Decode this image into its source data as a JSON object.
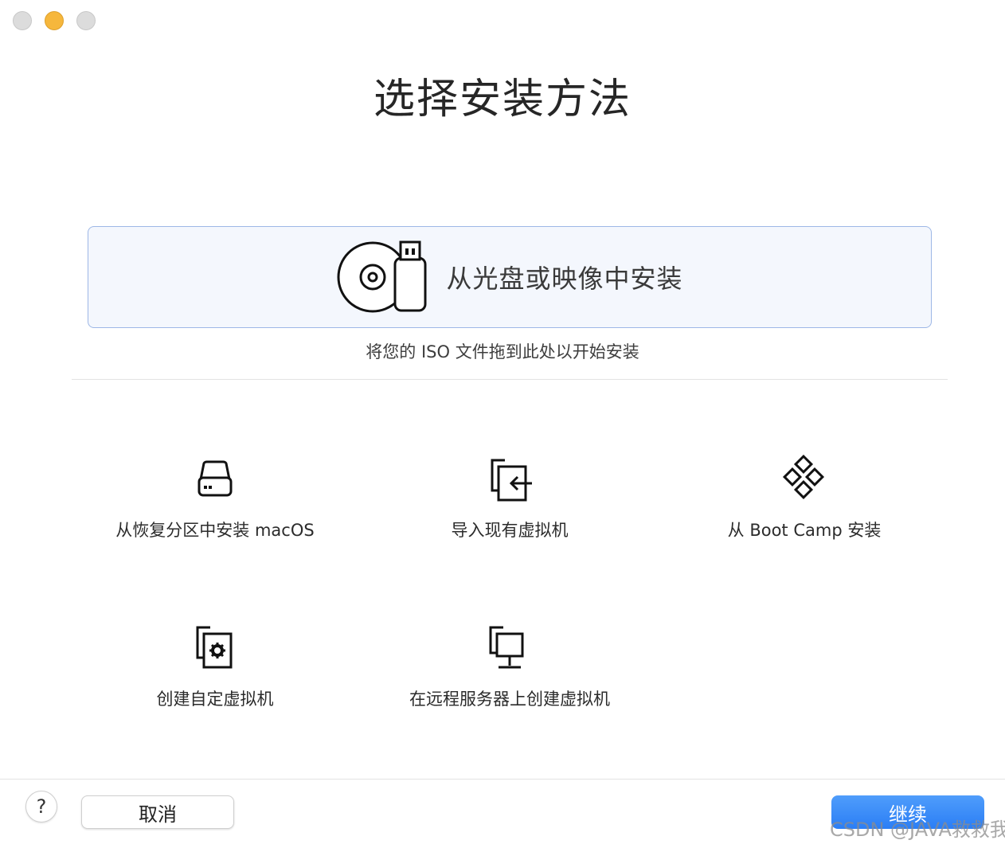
{
  "window": {
    "title": "选择安装方法"
  },
  "drop_zone": {
    "label": "从光盘或映像中安装",
    "icon": "disc-usb-icon",
    "hint": "将您的 ISO 文件拖到此处以开始安装"
  },
  "options": [
    {
      "label": "从恢复分区中安装 macOS",
      "icon": "hard-drive-icon"
    },
    {
      "label": "导入现有虚拟机",
      "icon": "import-vm-icon"
    },
    {
      "label": "从 Boot Camp 安装",
      "icon": "bootcamp-diamond-icon"
    },
    {
      "label": "创建自定虚拟机",
      "icon": "custom-vm-gear-icon"
    },
    {
      "label": "在远程服务器上创建虚拟机",
      "icon": "remote-server-icon"
    }
  ],
  "footer": {
    "help_label": "?",
    "cancel_label": "取消",
    "continue_label": "继续"
  },
  "watermark": "CSDN @JAVA救救我",
  "colors": {
    "accent": "#2b7ef5",
    "drop_zone_bg": "#f4f7fd",
    "drop_zone_border": "#9db7e6",
    "minimize": "#f6b73c"
  }
}
